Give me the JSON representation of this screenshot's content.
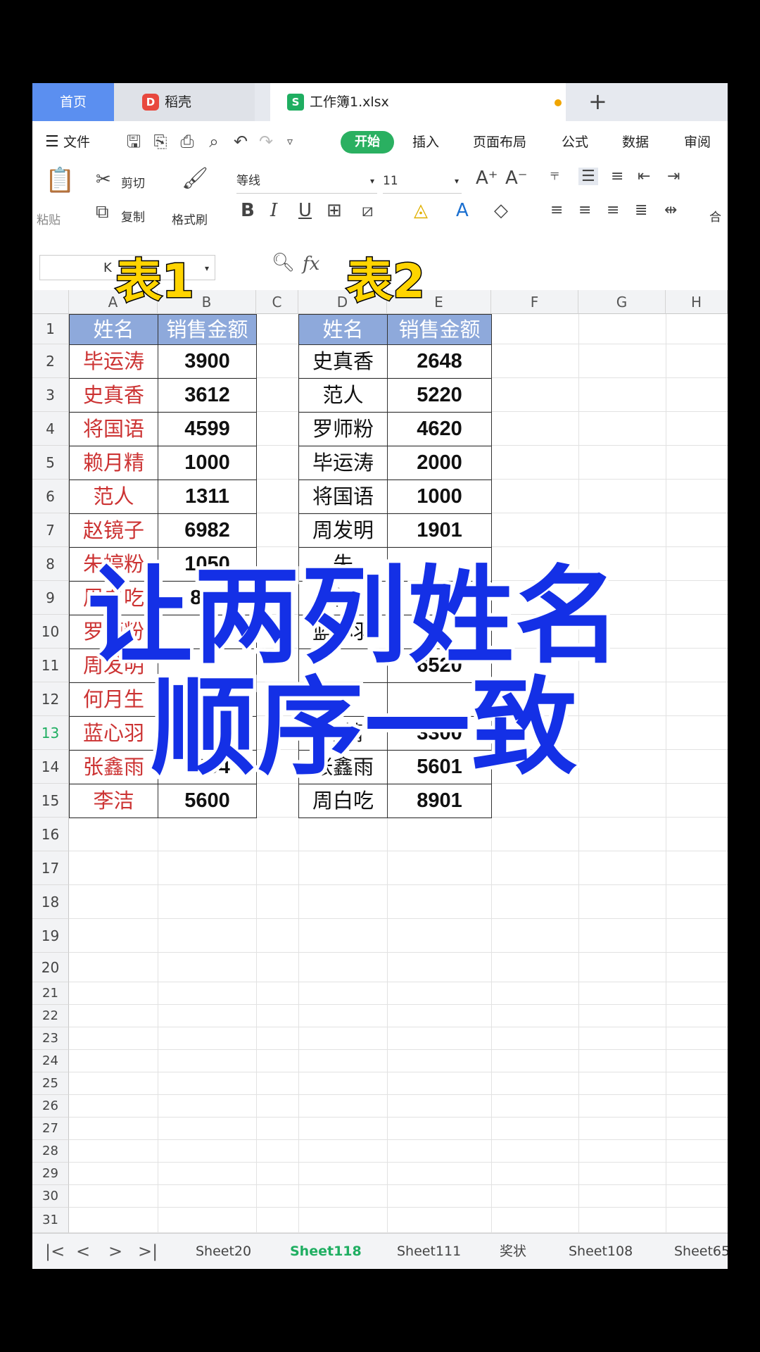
{
  "tabs": {
    "home": "首页",
    "daoke": "稻壳",
    "doc": "工作簿1.xlsx",
    "new": "+"
  },
  "menu": {
    "file": "文件",
    "items": [
      "开始",
      "插入",
      "页面布局",
      "公式",
      "数据",
      "审阅"
    ]
  },
  "ribbon": {
    "paste": "粘贴",
    "cut": "剪切",
    "copy": "复制",
    "format_painter": "格式刷",
    "font_name": "等线",
    "font_size": "11",
    "merge": "合"
  },
  "formula_bar": {
    "name_box": "K",
    "fx": "fx"
  },
  "columns": [
    "A",
    "B",
    "C",
    "D",
    "E",
    "F",
    "G",
    "H"
  ],
  "rows": [
    "1",
    "2",
    "3",
    "4",
    "5",
    "6",
    "7",
    "8",
    "9",
    "10",
    "11",
    "12",
    "13",
    "14",
    "15",
    "16",
    "17",
    "18",
    "19",
    "20",
    "21",
    "22",
    "23",
    "24",
    "25",
    "26",
    "27",
    "28",
    "29",
    "30",
    "31"
  ],
  "table1": {
    "header": [
      "姓名",
      "销售金额"
    ],
    "rows": [
      [
        "毕运涛",
        "3900"
      ],
      [
        "史真香",
        "3612"
      ],
      [
        "将国语",
        "4599"
      ],
      [
        "赖月精",
        "1000"
      ],
      [
        "范人",
        "1311"
      ],
      [
        "赵镜子",
        "6982"
      ],
      [
        "朱婷粉",
        "1050"
      ],
      [
        "周白吃",
        "852"
      ],
      [
        "罗师粉",
        ""
      ],
      [
        "周发明",
        ""
      ],
      [
        "何月生",
        ""
      ],
      [
        "蓝心羽",
        ""
      ],
      [
        "张鑫雨",
        "7894"
      ],
      [
        "李洁",
        "5600"
      ]
    ]
  },
  "table2": {
    "header": [
      "姓名",
      "销售金额"
    ],
    "rows": [
      [
        "史真香",
        "2648"
      ],
      [
        "范人",
        "5220"
      ],
      [
        "罗师粉",
        "4620"
      ],
      [
        "毕运涛",
        "2000"
      ],
      [
        "将国语",
        "1000"
      ],
      [
        "周发明",
        "1901"
      ],
      [
        "朱",
        ""
      ],
      [
        "何",
        ""
      ],
      [
        "蓝心羽",
        ""
      ],
      [
        "",
        "6520"
      ],
      [
        "",
        ""
      ],
      [
        "月精",
        "3300"
      ],
      [
        "张鑫雨",
        "5601"
      ],
      [
        "周白吃",
        "8901"
      ]
    ]
  },
  "sheets": [
    "Sheet20",
    "Sheet118",
    "Sheet111",
    "奖状",
    "Sheet108",
    "Sheet65"
  ],
  "active_sheet": "Sheet118",
  "overlay": {
    "label1": "表1",
    "label2": "表2",
    "line1": "让两列姓名",
    "line2": "顺序一致"
  },
  "colors": {
    "header_fill": "#8ea9db",
    "name_red": "#cc3333",
    "overlay_blue": "#1430e6",
    "overlay_yellow": "#ffd400",
    "accent_green": "#2ab061"
  }
}
